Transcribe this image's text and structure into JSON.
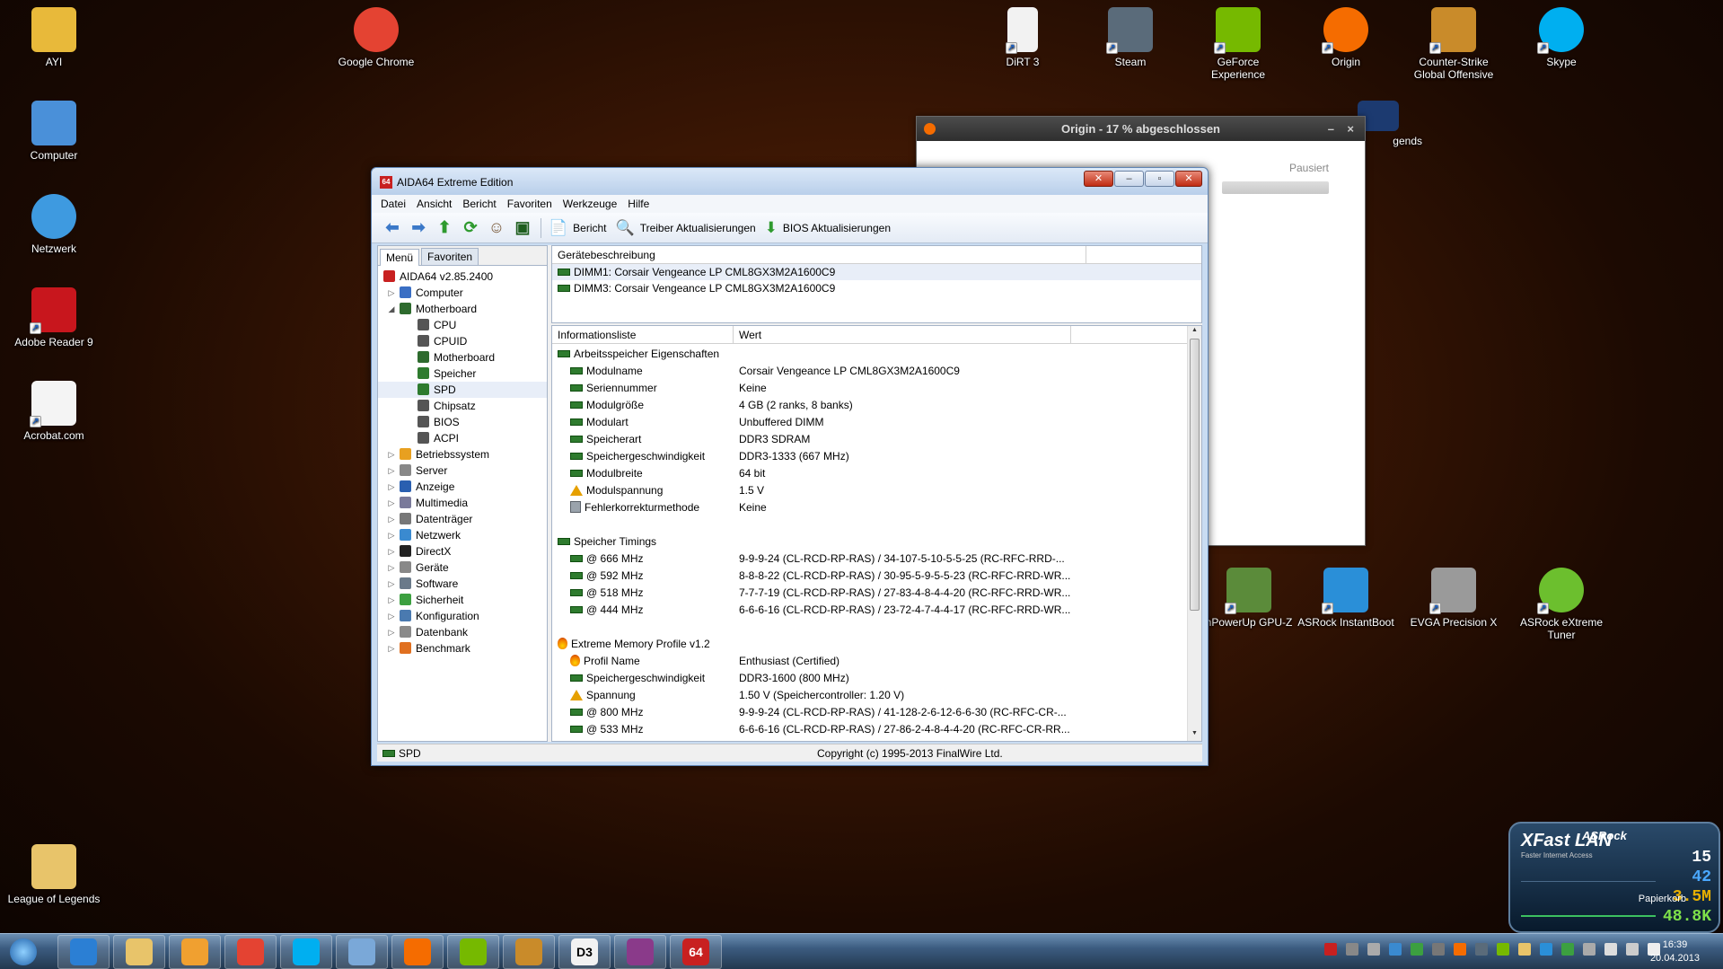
{
  "desktop": {
    "left_icons": [
      {
        "label": "AYI",
        "color": "#e8b93a"
      },
      {
        "label": "Computer",
        "color": "#4a90d9"
      },
      {
        "label": "Netzwerk",
        "color": "#3e9ae0"
      },
      {
        "label": "Adobe Reader 9",
        "color": "#c8161d"
      },
      {
        "label": "Acrobat.com",
        "color": "#f4f4f4"
      }
    ],
    "top_icons": [
      {
        "label": "Google Chrome",
        "color": "#e44332"
      },
      {
        "label": "DiRT 3",
        "color": "#f2f2f2"
      },
      {
        "label": "Steam",
        "color": "#5a6b7a"
      },
      {
        "label": "GeForce Experience",
        "color": "#76b900"
      },
      {
        "label": "Origin",
        "color": "#f56c00"
      },
      {
        "label": "Counter-Strike Global Offensive",
        "color": "#c98b2a"
      },
      {
        "label": "Skype",
        "color": "#00aff0"
      }
    ],
    "mid_icons": [
      {
        "label": "nPowerUp GPU-Z",
        "color": "#5b8b3a"
      },
      {
        "label": "ASRock InstantBoot",
        "color": "#2a8fd8"
      },
      {
        "label": "EVGA Precision X",
        "color": "#9a9a9a"
      },
      {
        "label": "ASRock eXtreme Tuner",
        "color": "#6cbf2e"
      }
    ],
    "partial_label": "gends",
    "bottom_icon": {
      "label": "League of Legends",
      "color": "#e8c46a"
    }
  },
  "origin": {
    "title": "Origin - 17 % abgeschlossen",
    "status": "Pausiert",
    "min": "–",
    "close": "×"
  },
  "aida": {
    "title": "AIDA64 Extreme Edition",
    "app_icon": "64",
    "menu": [
      "Datei",
      "Ansicht",
      "Bericht",
      "Favoriten",
      "Werkzeuge",
      "Hilfe"
    ],
    "toolbar": {
      "report": "Bericht",
      "driver_updates": "Treiber Aktualisierungen",
      "bios_updates": "BIOS Aktualisierungen"
    },
    "tabs": [
      "Menü",
      "Favoriten"
    ],
    "tree": [
      {
        "label": "AIDA64 v2.85.2400",
        "level": 0,
        "exp": "",
        "color": "#c82020"
      },
      {
        "label": "Computer",
        "level": 1,
        "exp": "▷",
        "color": "#3a6fc4"
      },
      {
        "label": "Motherboard",
        "level": 1,
        "exp": "◢",
        "color": "#2e6b2e"
      },
      {
        "label": "CPU",
        "level": 2,
        "exp": "",
        "color": "#555"
      },
      {
        "label": "CPUID",
        "level": 2,
        "exp": "",
        "color": "#555"
      },
      {
        "label": "Motherboard",
        "level": 2,
        "exp": "",
        "color": "#2e6b2e"
      },
      {
        "label": "Speicher",
        "level": 2,
        "exp": "",
        "color": "#2e7b2e"
      },
      {
        "label": "SPD",
        "level": 2,
        "exp": "",
        "color": "#2e7b2e"
      },
      {
        "label": "Chipsatz",
        "level": 2,
        "exp": "",
        "color": "#555"
      },
      {
        "label": "BIOS",
        "level": 2,
        "exp": "",
        "color": "#555"
      },
      {
        "label": "ACPI",
        "level": 2,
        "exp": "",
        "color": "#555"
      },
      {
        "label": "Betriebssystem",
        "level": 1,
        "exp": "▷",
        "color": "#e8a020"
      },
      {
        "label": "Server",
        "level": 1,
        "exp": "▷",
        "color": "#888"
      },
      {
        "label": "Anzeige",
        "level": 1,
        "exp": "▷",
        "color": "#2a5fb0"
      },
      {
        "label": "Multimedia",
        "level": 1,
        "exp": "▷",
        "color": "#7a7a9a"
      },
      {
        "label": "Datenträger",
        "level": 1,
        "exp": "▷",
        "color": "#777"
      },
      {
        "label": "Netzwerk",
        "level": 1,
        "exp": "▷",
        "color": "#3a8ad0"
      },
      {
        "label": "DirectX",
        "level": 1,
        "exp": "▷",
        "color": "#222"
      },
      {
        "label": "Geräte",
        "level": 1,
        "exp": "▷",
        "color": "#888"
      },
      {
        "label": "Software",
        "level": 1,
        "exp": "▷",
        "color": "#6a7a8a"
      },
      {
        "label": "Sicherheit",
        "level": 1,
        "exp": "▷",
        "color": "#3ca040"
      },
      {
        "label": "Konfiguration",
        "level": 1,
        "exp": "▷",
        "color": "#4a7ab0"
      },
      {
        "label": "Datenbank",
        "level": 1,
        "exp": "▷",
        "color": "#8a8a8a"
      },
      {
        "label": "Benchmark",
        "level": 1,
        "exp": "▷",
        "color": "#e07020"
      }
    ],
    "device_header": "Gerätebeschreibung",
    "devices": [
      "DIMM1: Corsair Vengeance LP CML8GX3M2A1600C9",
      "DIMM3: Corsair Vengeance LP CML8GX3M2A1600C9"
    ],
    "info_headers": [
      "Informationsliste",
      "Wert"
    ],
    "info_rows": [
      {
        "k": "Arbeitsspeicher Eigenschaften",
        "v": "",
        "group": true,
        "icon": "mem"
      },
      {
        "k": "Modulname",
        "v": "Corsair Vengeance LP CML8GX3M2A1600C9",
        "icon": "mem"
      },
      {
        "k": "Seriennummer",
        "v": "Keine",
        "icon": "mem"
      },
      {
        "k": "Modulgröße",
        "v": "4 GB (2 ranks, 8 banks)",
        "icon": "mem"
      },
      {
        "k": "Modulart",
        "v": "Unbuffered DIMM",
        "icon": "mem"
      },
      {
        "k": "Speicherart",
        "v": "DDR3 SDRAM",
        "icon": "mem"
      },
      {
        "k": "Speichergeschwindigkeit",
        "v": "DDR3-1333 (667 MHz)",
        "icon": "mem"
      },
      {
        "k": "Modulbreite",
        "v": "64 bit",
        "icon": "mem"
      },
      {
        "k": "Modulspannung",
        "v": "1.5 V",
        "icon": "warn"
      },
      {
        "k": "Fehlerkorrekturmethode",
        "v": "Keine",
        "icon": "chip"
      },
      {
        "k": "",
        "v": "",
        "blank": true
      },
      {
        "k": "Speicher Timings",
        "v": "",
        "group": true,
        "icon": "mem"
      },
      {
        "k": "@ 666 MHz",
        "v": "9-9-9-24  (CL-RCD-RP-RAS) / 34-107-5-10-5-5-25  (RC-RFC-RRD-...",
        "icon": "mem"
      },
      {
        "k": "@ 592 MHz",
        "v": "8-8-8-22  (CL-RCD-RP-RAS) / 30-95-5-9-5-5-23  (RC-RFC-RRD-WR...",
        "icon": "mem"
      },
      {
        "k": "@ 518 MHz",
        "v": "7-7-7-19  (CL-RCD-RP-RAS) / 27-83-4-8-4-4-20  (RC-RFC-RRD-WR...",
        "icon": "mem"
      },
      {
        "k": "@ 444 MHz",
        "v": "6-6-6-16  (CL-RCD-RP-RAS) / 23-72-4-7-4-4-17  (RC-RFC-RRD-WR...",
        "icon": "mem"
      },
      {
        "k": "",
        "v": "",
        "blank": true
      },
      {
        "k": "Extreme Memory Profile v1.2",
        "v": "",
        "group": true,
        "icon": "flame"
      },
      {
        "k": "Profil Name",
        "v": "Enthusiast (Certified)",
        "icon": "flame"
      },
      {
        "k": "Speichergeschwindigkeit",
        "v": "DDR3-1600 (800 MHz)",
        "icon": "mem"
      },
      {
        "k": "Spannung",
        "v": "1.50 V  (Speichercontroller: 1.20 V)",
        "icon": "warn"
      },
      {
        "k": "@ 800 MHz",
        "v": "9-9-9-24  (CL-RCD-RP-RAS) / 41-128-2-6-12-6-6-30  (RC-RFC-CR-...",
        "icon": "mem"
      },
      {
        "k": "@ 533 MHz",
        "v": "6-6-6-16  (CL-RCD-RP-RAS) / 27-86-2-4-8-4-4-20  (RC-RFC-CR-RR...",
        "icon": "mem"
      }
    ],
    "status_left": "SPD",
    "status_right": "Copyright (c) 1995-2013 FinalWire Ltd."
  },
  "taskbar": {
    "buttons": [
      {
        "name": "ie",
        "color": "#2b7fd4"
      },
      {
        "name": "explorer",
        "color": "#e8c46a"
      },
      {
        "name": "media-player",
        "color": "#f0a030"
      },
      {
        "name": "chrome",
        "color": "#e44332"
      },
      {
        "name": "skype",
        "color": "#00aff0"
      },
      {
        "name": "utorrent",
        "color": "#7aa8d8"
      },
      {
        "name": "origin",
        "color": "#f56c00"
      },
      {
        "name": "geforce",
        "color": "#76b900"
      },
      {
        "name": "csgo",
        "color": "#c98b2a"
      },
      {
        "name": "dirt3",
        "color": "#f2f2f2"
      },
      {
        "name": "winrar",
        "color": "#8a3a8a"
      },
      {
        "name": "aida64",
        "color": "#c82020"
      }
    ],
    "aida_label": "64",
    "dirt_label": "D3",
    "time": "16:39",
    "date": "20.04.2013"
  },
  "fastlan": {
    "brand": "ASRock",
    "title": "XFast LAN",
    "subtitle": "Faster Internet Access",
    "n1": "15",
    "n2": "42",
    "n3": "3.5M",
    "n4": "48.8K",
    "recycle": "Papierkorb"
  }
}
